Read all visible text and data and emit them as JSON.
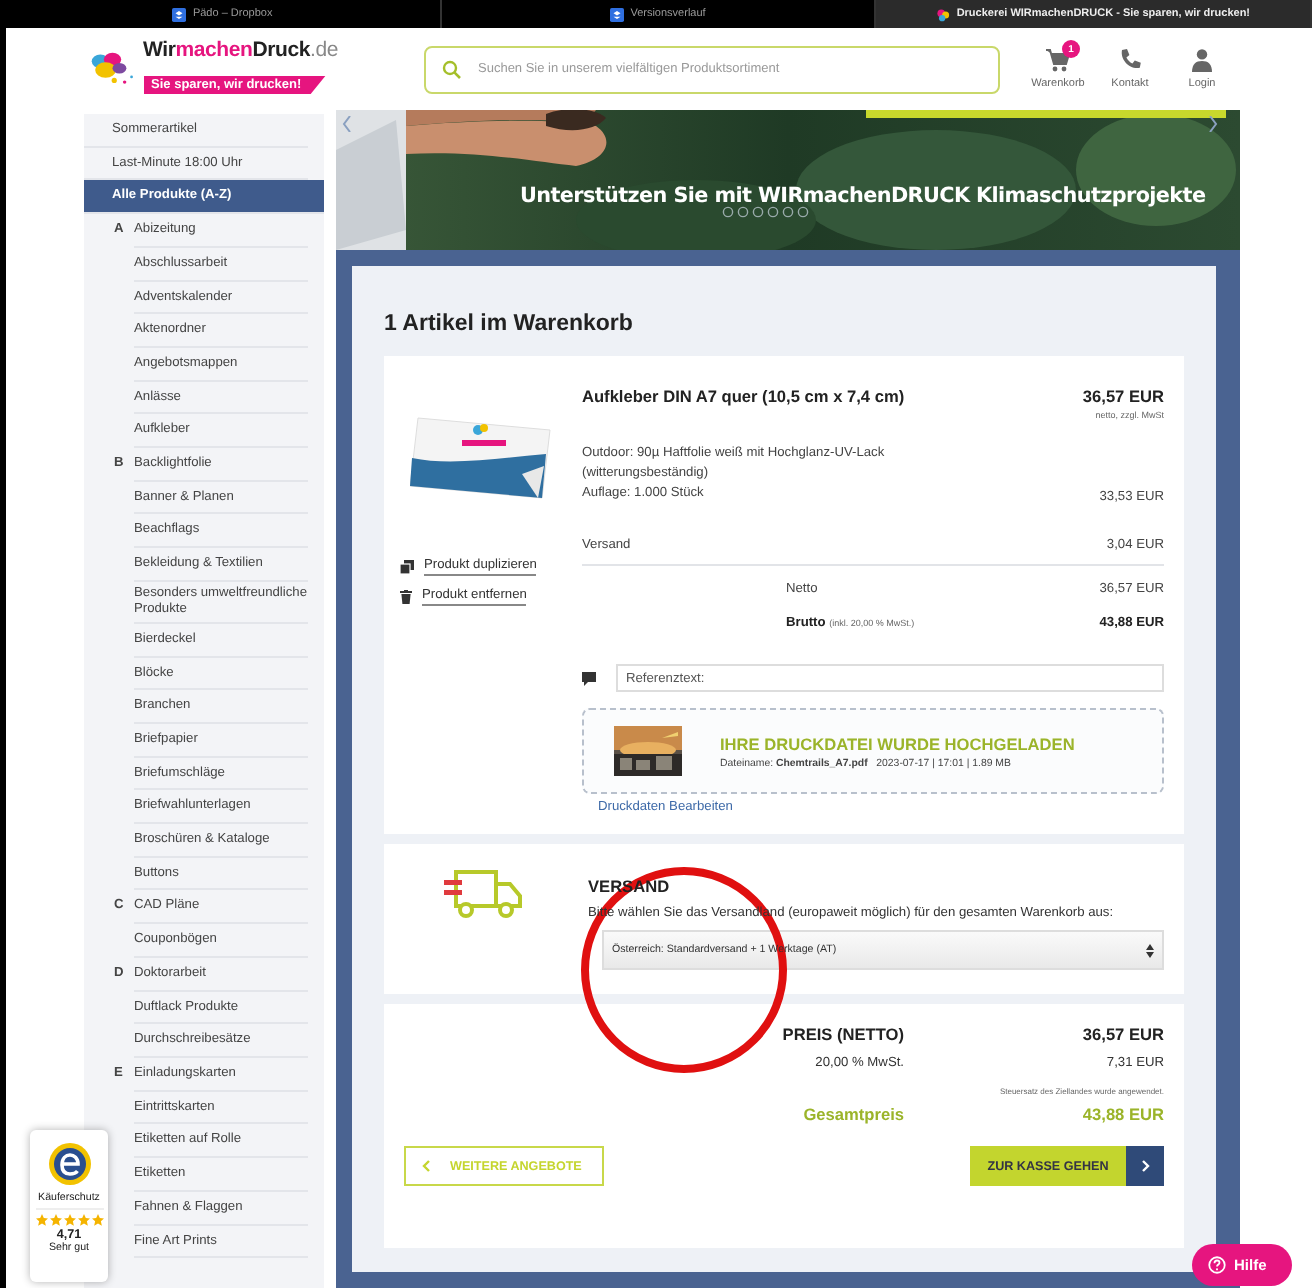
{
  "browser_tabs": [
    {
      "label": "Pädo – Dropbox",
      "kind": "box",
      "selected": false
    },
    {
      "label": "Versionsverlauf",
      "kind": "box",
      "selected": false
    },
    {
      "label": "Druckerei WIRmachenDRUCK - Sie sparen, wir drucken!",
      "kind": "site",
      "selected": true
    }
  ],
  "header": {
    "logo_parts": [
      "Wir",
      "machen",
      "Druck",
      ".de"
    ],
    "slogan": "Sie sparen, wir drucken!",
    "search": {
      "placeholder": "Suchen Sie in unserem vielfältigen Produktsortiment"
    },
    "nav": [
      {
        "label": "Warenkorb",
        "kind": "cart",
        "badge": "1"
      },
      {
        "label": "Kontakt",
        "kind": "phone"
      },
      {
        "label": "Login",
        "kind": "user"
      }
    ]
  },
  "banner": {
    "caption": "Unterstützen Sie mit WIRmachenDRUCK Klimaschutzprojekte"
  },
  "sidebar": {
    "items": [
      {
        "label": "Sommerartikel",
        "kind": "top",
        "selected": false
      },
      {
        "label": "Last-Minute 18:00 Uhr",
        "kind": "top",
        "selected": false
      },
      {
        "label": "Alle Produkte (A-Z)",
        "kind": "top",
        "selected": true
      },
      {
        "label": "Abizeitung",
        "kind": "product",
        "letter": "A",
        "selected": false
      },
      {
        "label": "Abschlussarbeit",
        "kind": "product",
        "selected": false
      },
      {
        "label": "Adventskalender",
        "kind": "product",
        "selected": false
      },
      {
        "label": "Aktenordner",
        "kind": "product",
        "selected": false
      },
      {
        "label": "Angebotsmappen",
        "kind": "product",
        "selected": false
      },
      {
        "label": "Anlässe",
        "kind": "product",
        "selected": false
      },
      {
        "label": "Aufkleber",
        "kind": "product",
        "selected": false
      },
      {
        "label": "Backlightfolie",
        "kind": "product",
        "letter": "B",
        "selected": false
      },
      {
        "label": "Banner & Planen",
        "kind": "product",
        "selected": false
      },
      {
        "label": "Beachflags",
        "kind": "product",
        "selected": false
      },
      {
        "label": "Bekleidung & Textilien",
        "kind": "product",
        "selected": false
      },
      {
        "label": "Besonders umweltfreundliche Produkte",
        "kind": "product",
        "selected": false
      },
      {
        "label": "Bierdeckel",
        "kind": "product",
        "selected": false
      },
      {
        "label": "Blöcke",
        "kind": "product",
        "selected": false
      },
      {
        "label": "Branchen",
        "kind": "product",
        "selected": false
      },
      {
        "label": "Briefpapier",
        "kind": "product",
        "selected": false
      },
      {
        "label": "Briefumschläge",
        "kind": "product",
        "selected": false
      },
      {
        "label": "Briefwahlunterlagen",
        "kind": "product",
        "selected": false
      },
      {
        "label": "Broschüren & Kataloge",
        "kind": "product",
        "selected": false
      },
      {
        "label": "Buttons",
        "kind": "product",
        "selected": false
      },
      {
        "label": "CAD Pläne",
        "kind": "product",
        "letter": "C",
        "selected": false
      },
      {
        "label": "Couponbögen",
        "kind": "product",
        "selected": false
      },
      {
        "label": "Doktorarbeit",
        "kind": "product",
        "letter": "D",
        "selected": false
      },
      {
        "label": "Duftlack Produkte",
        "kind": "product",
        "selected": false
      },
      {
        "label": "Durchschreibesätze",
        "kind": "product",
        "selected": false
      },
      {
        "label": "Einladungskarten",
        "kind": "product",
        "letter": "E",
        "selected": false
      },
      {
        "label": "Eintrittskarten",
        "kind": "product",
        "selected": false
      },
      {
        "label": "Etiketten auf Rolle",
        "kind": "product",
        "selected": false
      },
      {
        "label": "Etiketten",
        "kind": "product",
        "selected": false
      },
      {
        "label": "Fahnen & Flaggen",
        "kind": "product",
        "selected": false
      },
      {
        "label": "Fine Art Prints",
        "kind": "product",
        "selected": false
      }
    ]
  },
  "cart": {
    "title": "1 Artikel im Warenkorb",
    "actions": [
      {
        "label": "Produkt duplizieren",
        "kind": "duplicate"
      },
      {
        "label": "Produkt entfernen",
        "kind": "remove"
      }
    ],
    "product": {
      "name": "Aufkleber DIN A7 quer (10,5 cm x 7,4 cm)",
      "price": "36,57 EUR",
      "price_note": "netto, zzgl. MwSt",
      "description": "Outdoor: 90µ Haftfolie weiß mit Hochglanz-UV-Lack (witterungsbeständig)",
      "quantity": "Auflage: 1.000 Stück",
      "quantity_price": "33,53 EUR",
      "shipping_label": "Versand",
      "shipping_price": "3,04 EUR",
      "net_label": "Netto",
      "net_price": "36,57 EUR",
      "gross_label": "Brutto",
      "gross_note": "(inkl. 20,00 % MwSt.)",
      "gross_price": "43,88 EUR"
    },
    "reference": {
      "placeholder": "Referenztext:"
    },
    "upload": {
      "title": "IHRE DRUCKDATEI WURDE HOCHGELADEN",
      "file_label": "Dateiname:",
      "file_name": "Chemtrails_A7.pdf",
      "file_meta": "2023-07-17 | 17:01 | 1.89 MB"
    },
    "edit_link": "Druckdaten Bearbeiten"
  },
  "shipping": {
    "title": "VERSAND",
    "instruction": "Bitte wählen Sie das Versandland (europaweit möglich) für den gesamten Warenkorb aus:",
    "country": "Österreich: Standardversand + 1 Werktage (AT)"
  },
  "totals": {
    "net_label": "PREIS (NETTO)",
    "net_value": "36,57 EUR",
    "vat_label": "20,00 % MwSt.",
    "vat_value": "7,31 EUR",
    "tax_note": "Steuersatz des Ziellandes wurde angewendet.",
    "total_label": "Gesamtpreis",
    "total_value": "43,88 EUR",
    "back_button": "WEITERE ANGEBOTE",
    "checkout_button": "ZUR KASSE GEHEN"
  },
  "trust_badge": {
    "title": "Käuferschutz",
    "stars": 5,
    "rating": "4,71",
    "verdict": "Sehr gut"
  },
  "help_button": "Hilfe"
}
